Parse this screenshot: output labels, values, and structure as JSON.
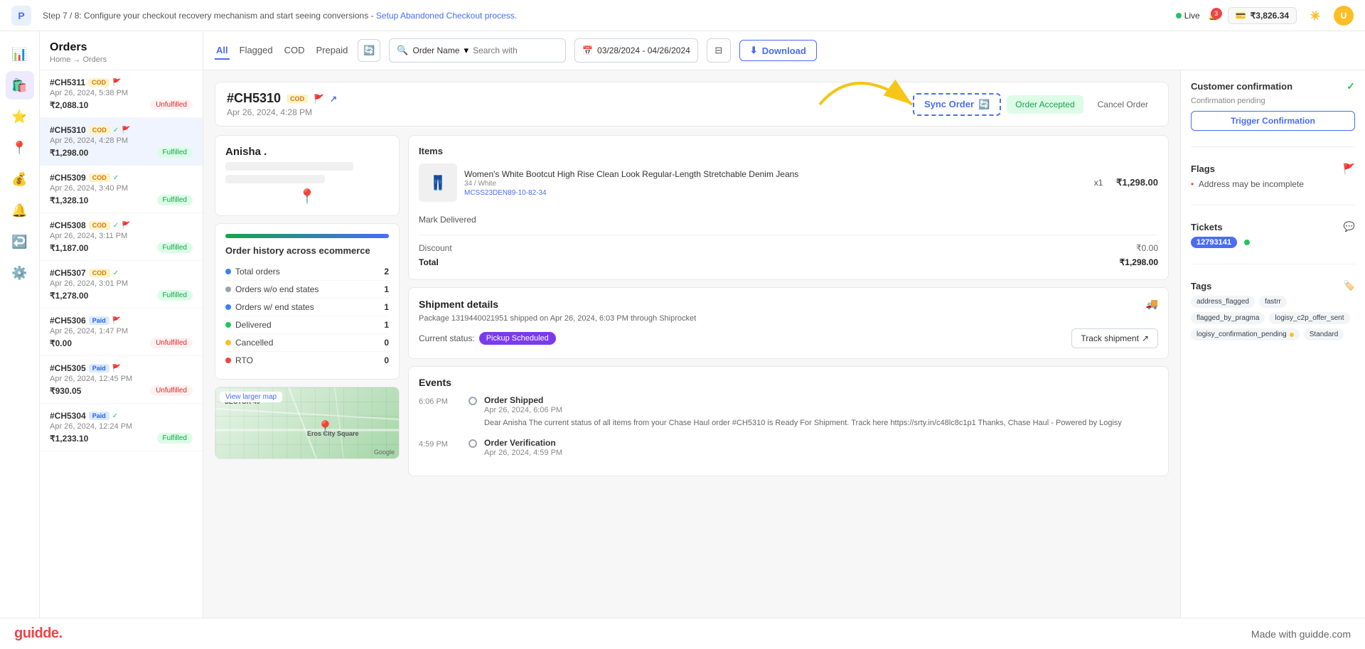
{
  "topbar": {
    "logo": "P",
    "step_text": "Step 7 / 8: Configure your checkout recovery mechanism and start seeing conversions - ",
    "step_link": "Setup Abandoned Checkout process.",
    "live_label": "Live",
    "notif_count": "3",
    "wallet_icon": "💳",
    "wallet_amount": "₹3,826.34",
    "user_initials": "U"
  },
  "sidebar": {
    "items": [
      {
        "icon": "📊",
        "label": "Analytics",
        "active": false
      },
      {
        "icon": "🛍️",
        "label": "Orders",
        "active": true
      },
      {
        "icon": "⭐",
        "label": "Reviews",
        "active": false
      },
      {
        "icon": "📍",
        "label": "Locations",
        "active": false
      },
      {
        "icon": "💰",
        "label": "Finance",
        "active": false
      },
      {
        "icon": "🔔",
        "label": "Notifications",
        "active": false
      },
      {
        "icon": "↩️",
        "label": "Returns",
        "active": false
      },
      {
        "icon": "⚙️",
        "label": "Settings",
        "active": false
      }
    ]
  },
  "orders_panel": {
    "title": "Orders",
    "breadcrumb": "Home → Orders",
    "items": [
      {
        "id": "#CH5311",
        "badge": "COD",
        "flag": true,
        "check": false,
        "date": "Apr 26, 2024, 5:38 PM",
        "amount": "₹2,088.10",
        "status": "Unfulfilled",
        "fulfilled": false,
        "selected": false
      },
      {
        "id": "#CH5310",
        "badge": "COD",
        "flag": true,
        "check": true,
        "date": "Apr 26, 2024, 4:28 PM",
        "amount": "₹1,298.00",
        "status": "Fulfilled",
        "fulfilled": true,
        "selected": true
      },
      {
        "id": "#CH5309",
        "badge": "COD",
        "flag": false,
        "check": true,
        "date": "Apr 26, 2024, 3:40 PM",
        "amount": "₹1,328.10",
        "status": "Fulfilled",
        "fulfilled": true,
        "selected": false
      },
      {
        "id": "#CH5308",
        "badge": "COD",
        "flag": true,
        "check": true,
        "date": "Apr 26, 2024, 3:11 PM",
        "amount": "₹1,187.00",
        "status": "Fulfilled",
        "fulfilled": true,
        "selected": false
      },
      {
        "id": "#CH5307",
        "badge": "COD",
        "flag": false,
        "check": true,
        "date": "Apr 26, 2024, 3:01 PM",
        "amount": "₹1,278.00",
        "status": "Fulfilled",
        "fulfilled": true,
        "selected": false
      },
      {
        "id": "#CH5306",
        "badge": "Paid",
        "flag": true,
        "check": false,
        "date": "Apr 26, 2024, 1:47 PM",
        "amount": "₹0.00",
        "status": "Unfulfilled",
        "fulfilled": false,
        "selected": false
      },
      {
        "id": "#CH5305",
        "badge": "Paid",
        "flag": true,
        "check": false,
        "date": "Apr 26, 2024, 12:45 PM",
        "amount": "₹930.05",
        "status": "Unfulfilled",
        "fulfilled": false,
        "selected": false
      },
      {
        "id": "#CH5304",
        "badge": "Paid",
        "flag": false,
        "check": true,
        "date": "Apr 26, 2024, 12:24 PM",
        "amount": "₹1,233.10",
        "status": "Fulfilled",
        "fulfilled": true,
        "selected": false
      }
    ]
  },
  "toolbar": {
    "tabs": [
      "All",
      "Flagged",
      "COD",
      "Prepaid"
    ],
    "active_tab": "All",
    "search_dropdown": "Order Name",
    "search_placeholder": "Search with",
    "date_range": "03/28/2024 - 04/26/2024",
    "download_label": "Download"
  },
  "order_detail": {
    "order_id": "#CH5310",
    "badge": "COD",
    "date": "Apr 26, 2024, 4:28 PM",
    "actions": {
      "sync_order": "Sync Order",
      "order_accepted": "Order Accepted",
      "cancel_order": "Cancel Order"
    },
    "customer": {
      "name": "Anisha ."
    },
    "order_history": {
      "title": "Order history across ecommerce",
      "items": [
        {
          "label": "Total orders",
          "count": "2",
          "dot": "blue"
        },
        {
          "label": "Orders w/o end states",
          "count": "1",
          "dot": "gray"
        },
        {
          "label": "Orders w/ end states",
          "count": "1",
          "dot": "blue"
        },
        {
          "label": "Delivered",
          "count": "1",
          "dot": "green"
        },
        {
          "label": "Cancelled",
          "count": "0",
          "dot": "yellow"
        },
        {
          "label": "RTO",
          "count": "0",
          "dot": "red"
        }
      ]
    },
    "items_section": {
      "title": "Items",
      "product": {
        "name": "Women's White Bootcut High Rise Clean Look Regular-Length Stretchable Denim Jeans",
        "size": "34 / White",
        "sku": "MCSS23DEN89-10-82-34",
        "qty": "x1",
        "price": "₹1,298.00"
      },
      "mark_delivered": "Mark Delivered",
      "discount_label": "Discount",
      "discount_value": "₹0.00",
      "total_label": "Total",
      "total_value": "₹1,298.00"
    },
    "shipment": {
      "title": "Shipment details",
      "package": "Package 1319440021951 shipped on Apr 26, 2024, 6:03 PM through Shiprocket",
      "current_status_label": "Current status:",
      "pickup_status": "Pickup Scheduled",
      "track_label": "Track shipment"
    },
    "events": {
      "title": "Events",
      "items": [
        {
          "time": "6:06 PM",
          "title": "Order Shipped",
          "date": "Apr 26, 2024, 6:06 PM",
          "desc": "Dear Anisha The current status of all items from your Chase Haul order #CH5310 is Ready For Shipment. Track here https://srty.in/c48lc8c1p1 Thanks, Chase Haul - Powered by Logisy"
        },
        {
          "time": "4:59 PM",
          "title": "Order Verification",
          "date": "Apr 26, 2024, 4:59 PM",
          "desc": ""
        }
      ]
    }
  },
  "right_sidebar": {
    "customer_confirmation": {
      "title": "Customer confirmation",
      "check_icon": "✓",
      "pending_text": "Confirmation pending",
      "trigger_btn": "Trigger Confirmation"
    },
    "flags": {
      "title": "Flags",
      "flag_icon": "🚩",
      "items": [
        "Address may be incomplete"
      ]
    },
    "tickets": {
      "title": "Tickets",
      "chat_icon": "💬",
      "ticket_id": "12793141",
      "green_dot": true
    },
    "tags": {
      "title": "Tags",
      "tag_icon": "🏷️",
      "items": [
        {
          "label": "address_flagged",
          "dot": false
        },
        {
          "label": "fastrr",
          "dot": false
        },
        {
          "label": "flagged_by_pragma",
          "dot": false
        },
        {
          "label": "logisy_c2p_offer_sent",
          "dot": false
        },
        {
          "label": "logisy_confirmation_pending",
          "dot": true
        },
        {
          "label": "Standard",
          "dot": false
        }
      ]
    }
  },
  "guidde_footer": {
    "logo": "guidde.",
    "made_with": "Made with guidde.com"
  }
}
